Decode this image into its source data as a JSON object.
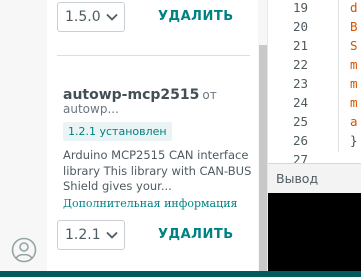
{
  "library_manager": {
    "top_item": {
      "version": "1.5.0",
      "remove_label": "УДАЛИТЬ"
    },
    "library": {
      "name": "autowp-mcp2515",
      "by_label": "от",
      "author": "autowp...",
      "installed_badge": "1.2.1 установлен",
      "description": "Arduino MCP2515 CAN interface library This library with CAN-BUS Shield gives your...",
      "more_info_label": "Дополнительная информация",
      "version": "1.2.1",
      "remove_label": "УДАЛИТЬ"
    }
  },
  "editor": {
    "lines": [
      {
        "num": "19",
        "code": "d",
        "color": "#d35400"
      },
      {
        "num": "20",
        "code": "B",
        "color": "#d35400"
      },
      {
        "num": "21",
        "code": "S",
        "color": "#d35400"
      },
      {
        "num": "22",
        "code": "m",
        "color": "#d35400"
      },
      {
        "num": "23",
        "code": "m",
        "color": "#d35400"
      },
      {
        "num": "24",
        "code": "m",
        "color": "#d35400"
      },
      {
        "num": "25",
        "code": "a",
        "color": "#d35400"
      },
      {
        "num": "26",
        "code": "}",
        "color": "#434f54"
      },
      {
        "num": "27",
        "code": "",
        "color": "#434f54"
      }
    ]
  },
  "output": {
    "title": "Вывод"
  },
  "colors": {
    "accent": "#008184",
    "status_bar": "#005a5e"
  },
  "icons": {
    "dropdown": "chevron-down-icon",
    "account": "account-icon"
  }
}
